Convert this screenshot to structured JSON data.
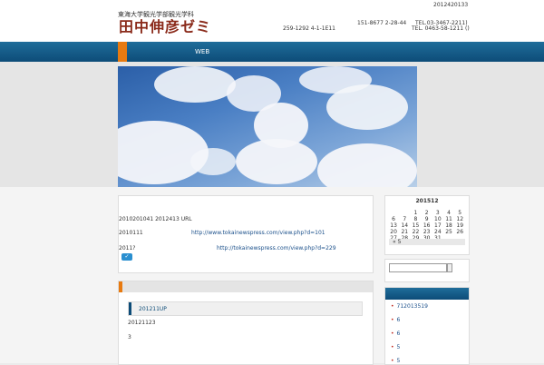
{
  "header": {
    "subtitle": "東海大学観光学部観光学科",
    "title": "田中伸彦ゼミ",
    "top_right": "2012420133",
    "address1": "259-1292 4-1-1E11",
    "address2": "151-8677 2-28-44",
    "tel1": "TEL.03-3467-2211)",
    "tel2": "TEL. 0463-58-1211 ()"
  },
  "nav": {
    "item1": "WEB"
  },
  "post1": {
    "line1": "2010201041 2012413 URL",
    "line2": "2010111",
    "link1": "http://www.tokainewspress.com/view.php?d=101",
    "line3": "2011?",
    "link2": "http://tokainewspress.com/view.php?d=229",
    "tweet_icon": "twitter-icon"
  },
  "post2": {
    "heading": "201211UP",
    "line1": "20121123",
    "line2": "3"
  },
  "calendar": {
    "title": "201512",
    "rows": [
      [
        "",
        "",
        "1",
        "2",
        "3",
        "4",
        "5"
      ],
      [
        "6",
        "7",
        "8",
        "9",
        "10",
        "11",
        "12"
      ],
      [
        "13",
        "14",
        "15",
        "16",
        "17",
        "18",
        "19"
      ],
      [
        "20",
        "21",
        "22",
        "23",
        "24",
        "25",
        "26"
      ],
      [
        "27",
        "28",
        "29",
        "30",
        "31",
        "",
        ""
      ]
    ],
    "prev": "« 5"
  },
  "sidebar": {
    "items": [
      "712013519",
      "6",
      "6",
      "5",
      "5"
    ]
  },
  "colors": {
    "accent": "#e87a10",
    "nav": "#0d4c78",
    "title": "#8a2a1a"
  }
}
